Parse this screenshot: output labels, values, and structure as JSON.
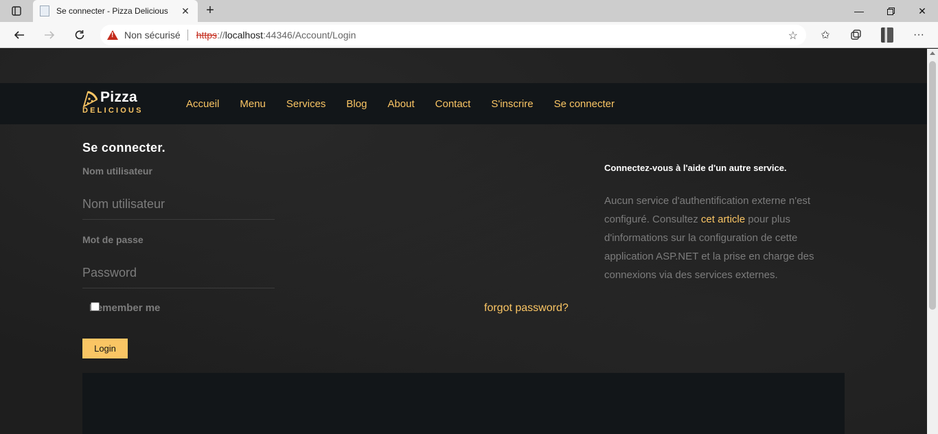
{
  "browser": {
    "tab_title": "Se connecter - Pizza Delicious",
    "security_label": "Non sécurisé",
    "url_scheme": "https",
    "url_sep": "://",
    "url_host": "localhost",
    "url_rest": ":44346/Account/Login"
  },
  "site": {
    "brand_name": "Pizza",
    "brand_sub": "DELICIOUS",
    "nav": [
      {
        "label": "Accueil"
      },
      {
        "label": "Menu"
      },
      {
        "label": "Services"
      },
      {
        "label": "Blog"
      },
      {
        "label": "About"
      },
      {
        "label": "Contact"
      },
      {
        "label": "S'inscrire"
      },
      {
        "label": "Se connecter"
      }
    ],
    "accent_color": "#fac564"
  },
  "login": {
    "title": "Se connecter.",
    "username_label": "Nom utilisateur",
    "username_placeholder": "Nom utilisateur",
    "password_label": "Mot de passe",
    "password_placeholder": "Password",
    "remember_label": "Remember me",
    "forgot_label": "forgot password?",
    "submit_label": "Login"
  },
  "external": {
    "heading": "Connectez-vous à l'aide d'un autre service.",
    "text_before": "Aucun service d'authentification externe n'est configuré. Consultez ",
    "link_text": "cet article",
    "text_after": " pour plus d'informations sur la configuration de cette application ASP.NET et la prise en charge des connexions via des services externes."
  }
}
